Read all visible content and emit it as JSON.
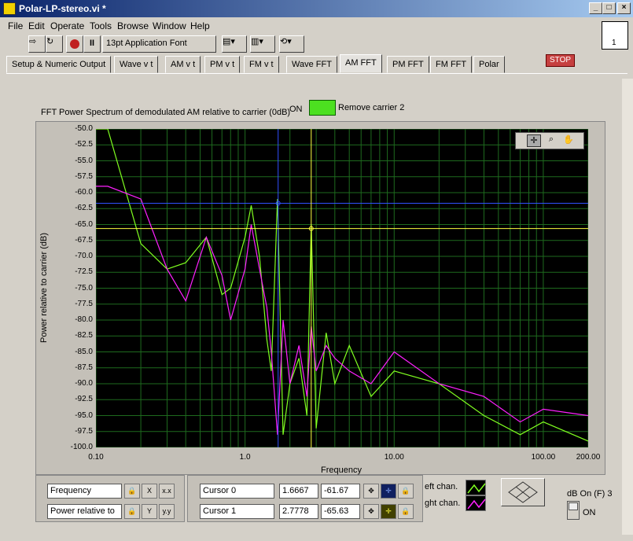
{
  "window": {
    "title": "Polar-LP-stereo.vi *"
  },
  "menu": [
    "File",
    "Edit",
    "Operate",
    "Tools",
    "Browse",
    "Window",
    "Help"
  ],
  "toolbar": {
    "font": "13pt Application Font"
  },
  "vi_icon_label": "1",
  "tabs": [
    "Setup & Numeric Output",
    "Wave v t",
    "AM v t",
    "PM v t",
    "FM  v t",
    "Wave FFT",
    "AM FFT",
    "PM FFT",
    "FM FFT",
    "Polar"
  ],
  "stop_label": "STOP",
  "graph": {
    "title": "FFT Power Spectrum of demodulated AM relative to carrier (0dB)",
    "on_label": "ON",
    "remove_carrier": "Remove carrier  2",
    "ylabel": "Power relative to carrier (dB)",
    "xlabel": "Frequency"
  },
  "chart_data": {
    "type": "line",
    "xscale": "log",
    "xlim": [
      0.1,
      200
    ],
    "ylim": [
      -100,
      -50
    ],
    "x_ticks": [
      "0.10",
      "1.0",
      "10.00",
      "100.00",
      "200.00"
    ],
    "y_ticks": [
      "-50.0",
      "-52.5",
      "-55.0",
      "-57.5",
      "-60.0",
      "-62.5",
      "-65.0",
      "-67.5",
      "-70.0",
      "-72.5",
      "-75.0",
      "-77.5",
      "-80.0",
      "-82.5",
      "-85.0",
      "-87.5",
      "-90.0",
      "-92.5",
      "-95.0",
      "-97.5",
      "-100.0"
    ],
    "series": [
      {
        "name": "Left chan.",
        "color": "#80ff20",
        "x": [
          0.1,
          0.12,
          0.2,
          0.3,
          0.4,
          0.55,
          0.7,
          0.8,
          1.0,
          1.1,
          1.25,
          1.4,
          1.5,
          1.65,
          1.8,
          2.0,
          2.3,
          2.6,
          2.78,
          3.0,
          3.5,
          4,
          5,
          7,
          10,
          20,
          40,
          70,
          100,
          200
        ],
        "y": [
          -50,
          -50,
          -68,
          -72,
          -71,
          -67,
          -76,
          -75,
          -67,
          -62,
          -70,
          -83,
          -88,
          -61,
          -98,
          -90,
          -86,
          -95,
          -65,
          -97,
          -82,
          -90,
          -84,
          -92,
          -88,
          -90,
          -95,
          -98,
          -96,
          -99
        ]
      },
      {
        "name": "Right chan.",
        "color": "#ff20ff",
        "x": [
          0.1,
          0.12,
          0.2,
          0.3,
          0.4,
          0.55,
          0.7,
          0.8,
          1.0,
          1.1,
          1.25,
          1.4,
          1.5,
          1.65,
          1.8,
          2.0,
          2.3,
          2.6,
          2.78,
          3.0,
          3.5,
          4,
          5,
          7,
          10,
          20,
          40,
          70,
          100,
          200
        ],
        "y": [
          -59,
          -59,
          -61,
          -72,
          -77,
          -67,
          -73,
          -80,
          -72,
          -65,
          -72,
          -78,
          -85,
          -98,
          -80,
          -90,
          -84,
          -92,
          -81,
          -88,
          -84,
          -86,
          -88,
          -90,
          -85,
          -90,
          -92,
          -96,
          -94,
          -95
        ]
      }
    ],
    "cursors": [
      {
        "name": "Cursor 0",
        "x": 1.6667,
        "y": -61.67,
        "color": "#3050ff"
      },
      {
        "name": "Cursor 1",
        "x": 2.7778,
        "y": -65.63,
        "color": "#ffff40"
      }
    ]
  },
  "legend": {
    "x_name": "Frequency",
    "y_name": "Power relative to",
    "cursor0": {
      "name": "Cursor 0",
      "x": "1.6667",
      "y": "-61.67"
    },
    "cursor1": {
      "name": "Cursor 1",
      "x": "2.7778",
      "y": "-65.63"
    },
    "left_chan": "eft chan.",
    "right_chan": "ght chan."
  },
  "db_toggle": {
    "label": "dB On (F) 3",
    "state": "ON"
  }
}
